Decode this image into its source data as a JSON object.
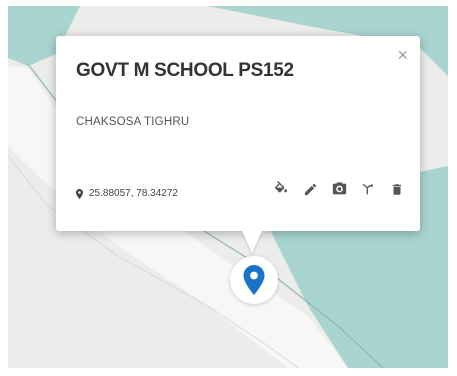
{
  "popup": {
    "title": "GOVT M SCHOOL PS152",
    "subtitle": "CHAKSOSA TIGHRU",
    "close_glyph": "×",
    "coordinates": "25.88057, 78.34272",
    "actions": [
      {
        "name": "fill-icon"
      },
      {
        "name": "pencil-icon"
      },
      {
        "name": "camera-icon"
      },
      {
        "name": "directions-icon"
      },
      {
        "name": "trash-icon"
      }
    ]
  },
  "colors": {
    "water": "#a9d4d0",
    "land": "#ececea",
    "road": "#ffffff",
    "marker": "#1a73c8"
  }
}
